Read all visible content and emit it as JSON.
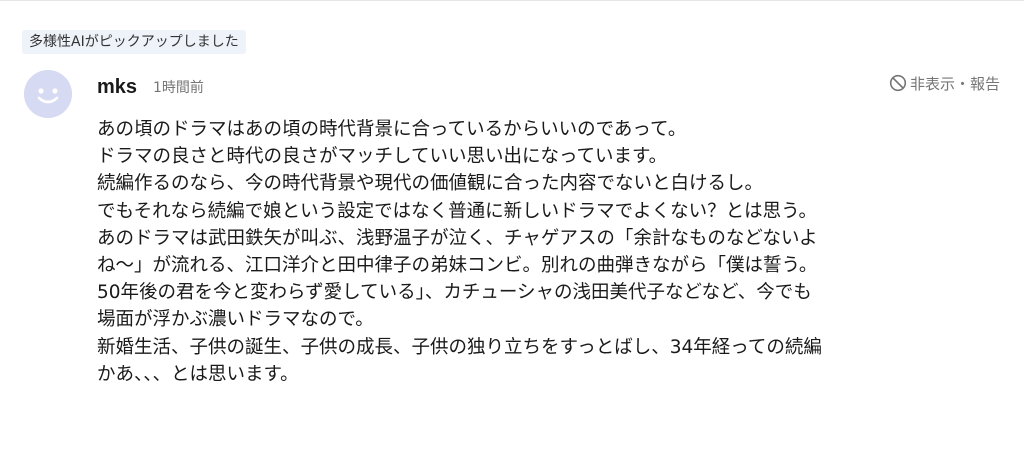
{
  "ai_badge": "多様性AIがピックアップしました",
  "comment": {
    "username": "mks",
    "timestamp": "1時間前",
    "actions": {
      "hide_report_label": "非表示・報告",
      "icon": "block-icon"
    },
    "avatar": {
      "icon": "smiley-avatar",
      "background": "#d7daf3",
      "face_color": "#ffffff"
    },
    "lines": [
      "あの頃のドラマはあの頃の時代背景に合っているからいいのであって。",
      "ドラマの良さと時代の良さがマッチしていい思い出になっています。",
      "続編作るのなら、今の時代背景や現代の価値観に合った内容でないと白けるし。",
      "でもそれなら続編で娘という設定ではなく普通に新しいドラマでよくない？とは思う。",
      "あのドラマは武田鉄矢が叫ぶ、浅野温子が泣く、チャゲアスの「余計なものなどないよ",
      "ね〜」が流れる、江口洋介と田中律子の弟妹コンビ。別れの曲弾きながら「僕は誓う。",
      "50年後の君を今と変わらず愛している」、カチューシャの浅田美代子などなど、今でも",
      "場面が浮かぶ濃いドラマなので。",
      "新婚生活、子供の誕生、子供の成長、子供の独り立ちをすっとばし、34年経っての続編",
      "かあ、、、とは思います。"
    ]
  },
  "colors": {
    "badge_background": "#eef2f9",
    "muted_text": "#767676",
    "body_text": "#1a1a1a"
  }
}
